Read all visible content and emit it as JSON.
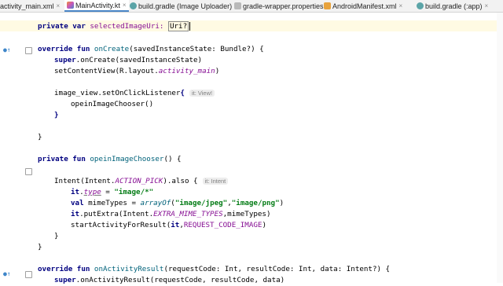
{
  "tabs": [
    {
      "label": "activity_main.xml",
      "icon": "xml-file-icon",
      "close": "×",
      "active": false
    },
    {
      "label": "MainActivity.kt",
      "icon": "kotlin-file-icon",
      "close": "×",
      "active": true
    },
    {
      "label": "build.gradle (Image Uploader)",
      "icon": "gradle-file-icon",
      "close": "×",
      "active": false
    },
    {
      "label": "gradle-wrapper.properties",
      "icon": "properties-file-icon",
      "close": "×",
      "active": false
    },
    {
      "label": "AndroidManifest.xml",
      "icon": "xml-file-icon",
      "close": "×",
      "active": false
    },
    {
      "label": "build.gradle (:app)",
      "icon": "gradle-file-icon",
      "close": "×",
      "active": false
    }
  ],
  "code": {
    "l1": {
      "kw": "private var",
      "name": " selectedImageUri: ",
      "type": "Uri?"
    },
    "l2": {
      "kw": "override fun",
      "fn": " onCreate",
      "rest": "(savedInstanceState: Bundle?) {"
    },
    "l3": {
      "kw": "super",
      "rest": ".onCreate(savedInstanceState)"
    },
    "l4": {
      "pre": "setContentView(R.layout.",
      "prop": "activity_main",
      "post": ")"
    },
    "l5": {
      "text": "image_view.setOnClickListener",
      "brace": "{",
      "hint": "it: View!"
    },
    "l6": {
      "text": "opeinImageChooser()"
    },
    "l7": {
      "text": "}"
    },
    "l8": {
      "text": "}"
    },
    "l9": {
      "kw": "private fun",
      "fn": " opeinImageChooser",
      "rest": "() {"
    },
    "l10": {
      "pre": "Intent(Intent.",
      "prop": "ACTION_PICK",
      "post": ").also {",
      "hint": "it: Intent"
    },
    "l11": {
      "it": "it",
      "dot": ".",
      "prop": "type",
      "eq": " = ",
      "str": "\"image/*\""
    },
    "l12": {
      "kw": "val",
      "pre": " mimeTypes = ",
      "fn": "arrayOf",
      "open": "(",
      "s1": "\"image/jpeg\"",
      "comma": ",",
      "s2": "\"image/png\"",
      "close": ")"
    },
    "l13": {
      "it": "it",
      "pre": ".putExtra(Intent.",
      "prop": "EXTRA_MIME_TYPES",
      "post": ",mimeTypes)"
    },
    "l14": {
      "pre": "startActivityForResult(",
      "it": "it",
      "comma": ",",
      "field": "REQUEST_CODE_IMAGE",
      "post": ")"
    },
    "l15": {
      "text": "}"
    },
    "l16": {
      "text": "}"
    },
    "l17": {
      "kw": "override fun",
      "fn": " onActivityResult",
      "rest": "(requestCode: Int, resultCode: Int, data: Intent?) {"
    },
    "l18": {
      "kw": "super",
      "rest": ".onActivityResult(requestCode, resultCode, data)"
    }
  }
}
